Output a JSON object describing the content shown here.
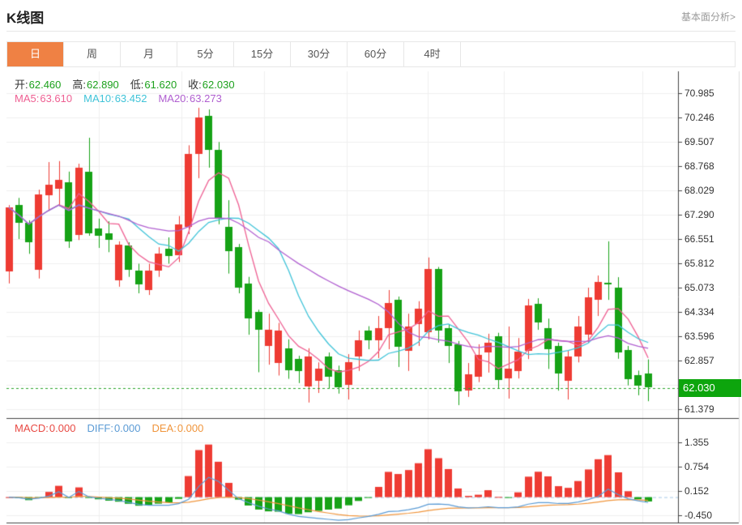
{
  "header": {
    "title": "K线图",
    "analysis_link": "基本面分析>"
  },
  "tabs": {
    "items": [
      "日",
      "周",
      "月",
      "5分",
      "15分",
      "30分",
      "60分",
      "4时"
    ],
    "selected_index": 0,
    "active_bg": "#ef8144"
  },
  "ohlc_legend": {
    "label_color": "#333333",
    "value_color": "#1ca11c",
    "items": [
      {
        "label": "开:",
        "value": "62.460"
      },
      {
        "label": "高:",
        "value": "62.890"
      },
      {
        "label": "低:",
        "value": "61.620"
      },
      {
        "label": "收:",
        "value": "62.030"
      }
    ]
  },
  "ma_legend": {
    "items": [
      {
        "label": "MA5:",
        "value": "63.610",
        "color": "#ee5f92"
      },
      {
        "label": "MA10:",
        "value": "63.452",
        "color": "#3fc3d8"
      },
      {
        "label": "MA20:",
        "value": "63.273",
        "color": "#b05fd0"
      }
    ]
  },
  "macd_legend": {
    "items": [
      {
        "label": "MACD:",
        "value": "0.000",
        "color": "#e84a44"
      },
      {
        "label": "DIFF:",
        "value": "0.000",
        "color": "#5b9bd5"
      },
      {
        "label": "DEA:",
        "value": "0.000",
        "color": "#f0953c"
      }
    ]
  },
  "price_badge": {
    "value": "62.030",
    "bg": "#0da50d"
  },
  "y_axis": {
    "main_tick_labels": [
      "70.985",
      "70.246",
      "69.507",
      "68.768",
      "68.029",
      "67.290",
      "66.551",
      "65.812",
      "65.073",
      "64.334",
      "63.596",
      "62.857",
      "61.379"
    ],
    "macd_tick_labels": [
      "1.355",
      "0.754",
      "0.152",
      "-0.450"
    ]
  },
  "chart_data": {
    "type": "candlestick",
    "title": "K线图 daily candles with MA5/MA10/MA20 and MACD",
    "up_color": "#ee3b33",
    "down_color": "#16a216",
    "ma_colors": {
      "ma5": "#ee5f92",
      "ma10": "#3fc3d8",
      "ma20": "#b05fd0"
    },
    "macd_colors": {
      "diff": "#5b9bd5",
      "dea": "#f0953c",
      "zero_line": "#a6c9e6"
    },
    "current_price": 62.03,
    "current_price_line_color": "#2aa52a",
    "price_axis": {
      "ticks": [
        70.985,
        70.246,
        69.507,
        68.768,
        68.029,
        67.29,
        66.551,
        65.812,
        65.073,
        64.334,
        63.596,
        62.857,
        61.379
      ],
      "step": 0.739
    },
    "macd_axis": {
      "ticks": [
        1.355,
        0.754,
        0.152,
        -0.45
      ]
    },
    "grid_vlines_x": [
      122,
      224,
      326,
      428,
      528,
      622,
      793
    ],
    "candles_format": [
      "open",
      "close",
      "low",
      "high"
    ],
    "candles": [
      [
        65.57,
        67.51,
        65.2,
        67.58
      ],
      [
        67.58,
        67.05,
        66.55,
        67.8
      ],
      [
        67.05,
        66.45,
        66.1,
        67.12
      ],
      [
        65.62,
        67.91,
        65.35,
        68.05
      ],
      [
        67.88,
        68.2,
        67.4,
        68.89
      ],
      [
        68.08,
        68.35,
        67.55,
        68.92
      ],
      [
        68.28,
        66.48,
        66.28,
        68.6
      ],
      [
        66.68,
        68.72,
        66.52,
        68.84
      ],
      [
        68.6,
        66.74,
        66.65,
        69.63
      ],
      [
        66.87,
        66.65,
        66.28,
        67.17
      ],
      [
        66.72,
        66.52,
        66.15,
        67.09
      ],
      [
        65.3,
        66.38,
        65.1,
        66.48
      ],
      [
        66.35,
        65.62,
        65.4,
        66.45
      ],
      [
        65.6,
        65.18,
        64.9,
        65.8
      ],
      [
        65.02,
        65.6,
        64.85,
        65.8
      ],
      [
        65.58,
        66.1,
        65.4,
        66.3
      ],
      [
        66.25,
        66.02,
        65.8,
        66.6
      ],
      [
        66.06,
        67.0,
        65.85,
        67.25
      ],
      [
        66.92,
        69.14,
        66.7,
        69.4
      ],
      [
        69.14,
        70.25,
        68.4,
        70.54
      ],
      [
        70.3,
        69.26,
        68.72,
        70.49
      ],
      [
        69.26,
        67.17,
        67.0,
        69.5
      ],
      [
        66.92,
        66.18,
        65.5,
        67.73
      ],
      [
        66.3,
        65.07,
        64.9,
        66.4
      ],
      [
        65.19,
        64.14,
        63.64,
        65.4
      ],
      [
        64.33,
        63.79,
        62.5,
        64.4
      ],
      [
        63.3,
        63.79,
        62.73,
        64.28
      ],
      [
        62.78,
        63.77,
        62.4,
        64.0
      ],
      [
        63.23,
        62.56,
        62.3,
        63.5
      ],
      [
        62.91,
        62.54,
        62.17,
        63.0
      ],
      [
        62.07,
        62.98,
        61.58,
        63.23
      ],
      [
        62.24,
        62.61,
        61.87,
        62.8
      ],
      [
        62.98,
        62.36,
        62.0,
        63.1
      ],
      [
        62.56,
        62.04,
        61.85,
        62.7
      ],
      [
        62.12,
        62.81,
        61.67,
        63.05
      ],
      [
        62.98,
        63.47,
        62.54,
        63.77
      ],
      [
        63.77,
        63.47,
        63.2,
        63.9
      ],
      [
        63.47,
        63.84,
        62.93,
        64.21
      ],
      [
        63.84,
        64.6,
        63.2,
        65.0
      ],
      [
        64.7,
        63.27,
        62.66,
        64.8
      ],
      [
        63.15,
        63.89,
        62.54,
        64.28
      ],
      [
        63.96,
        64.43,
        63.3,
        64.66
      ],
      [
        63.72,
        65.64,
        63.5,
        65.99
      ],
      [
        65.64,
        63.77,
        63.4,
        65.7
      ],
      [
        63.84,
        63.3,
        62.78,
        63.95
      ],
      [
        63.35,
        61.92,
        61.5,
        63.45
      ],
      [
        61.94,
        62.44,
        61.75,
        62.78
      ],
      [
        62.36,
        63.03,
        62.2,
        63.35
      ],
      [
        63.1,
        63.4,
        62.49,
        63.67
      ],
      [
        63.59,
        62.25,
        62.0,
        63.7
      ],
      [
        62.31,
        62.61,
        61.7,
        63.89
      ],
      [
        62.54,
        63.13,
        62.31,
        63.54
      ],
      [
        63.15,
        64.53,
        62.9,
        64.73
      ],
      [
        64.58,
        64.01,
        63.79,
        64.75
      ],
      [
        63.84,
        63.2,
        62.6,
        64.13
      ],
      [
        63.3,
        62.46,
        61.94,
        63.4
      ],
      [
        62.24,
        62.98,
        61.67,
        63.15
      ],
      [
        62.98,
        63.89,
        62.8,
        64.21
      ],
      [
        63.64,
        64.78,
        63.4,
        65.07
      ],
      [
        64.7,
        65.24,
        64.21,
        65.44
      ],
      [
        65.22,
        65.17,
        64.7,
        66.48
      ],
      [
        65.07,
        63.1,
        62.91,
        65.39
      ],
      [
        63.18,
        62.29,
        62.1,
        63.3
      ],
      [
        62.42,
        62.1,
        61.8,
        62.55
      ],
      [
        62.46,
        62.03,
        61.62,
        62.89
      ]
    ]
  }
}
